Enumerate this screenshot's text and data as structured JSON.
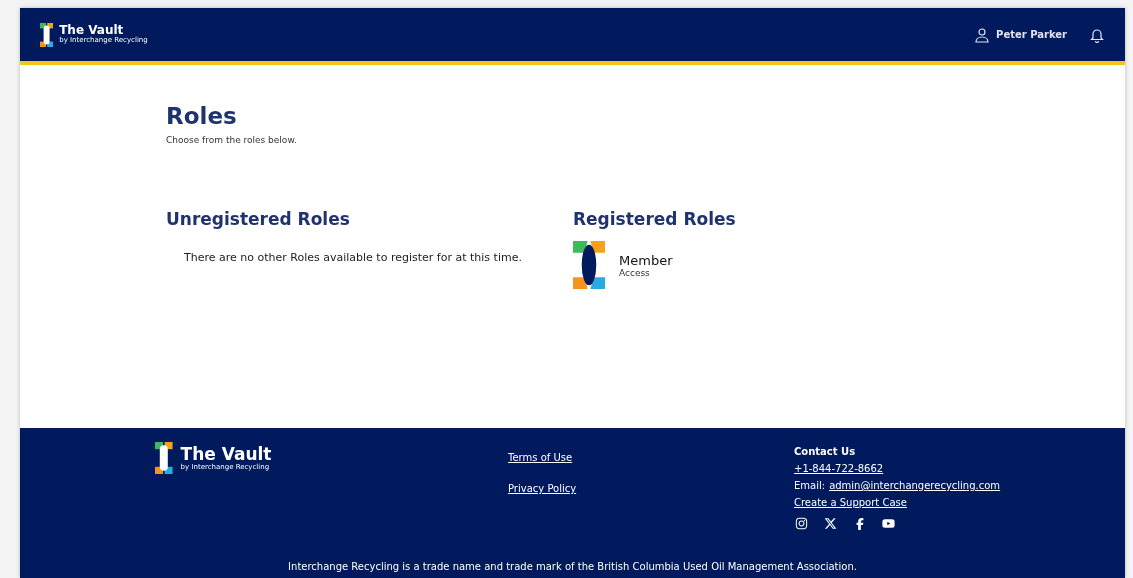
{
  "header": {
    "brand": {
      "title": "The Vault",
      "subtitle": "by Interchange Recycling"
    },
    "user": "Peter Parker"
  },
  "page": {
    "title": "Roles",
    "subtitle": "Choose from the roles below."
  },
  "unregistered": {
    "heading": "Unregistered Roles",
    "empty_message": "There are no other Roles available to register for at this time."
  },
  "registered": {
    "heading": "Registered Roles",
    "roles": [
      {
        "name": "Member",
        "detail": "Access"
      }
    ]
  },
  "footer": {
    "brand": {
      "title": "The Vault",
      "subtitle": "by Interchange Recycling"
    },
    "links": [
      "Terms of Use",
      "Privacy Policy"
    ],
    "contact": {
      "heading": "Contact Us",
      "phone": "+1-844-722-8662",
      "email_label": "Email:",
      "email": "admin@interchangerecycling.com",
      "support": "Create a Support Case"
    },
    "social": [
      {
        "kind": "instagram"
      },
      {
        "kind": "x"
      },
      {
        "kind": "facebook"
      },
      {
        "kind": "youtube"
      }
    ],
    "legal": "Interchange Recycling is a trade name and trade mark of the British Columbia Used Oil Management Association."
  }
}
